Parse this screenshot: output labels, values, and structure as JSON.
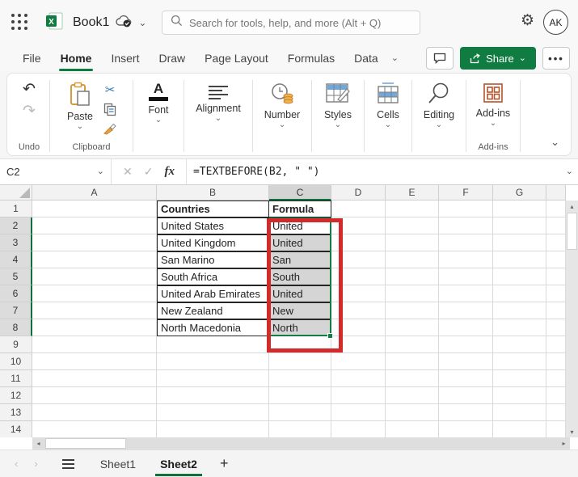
{
  "topbar": {
    "workbook_title": "Book1",
    "search_placeholder": "Search for tools, help, and more (Alt + Q)",
    "avatar_initials": "AK"
  },
  "menubar": {
    "tabs": [
      {
        "label": "File",
        "active": false
      },
      {
        "label": "Home",
        "active": true
      },
      {
        "label": "Insert",
        "active": false
      },
      {
        "label": "Draw",
        "active": false
      },
      {
        "label": "Page Layout",
        "active": false
      },
      {
        "label": "Formulas",
        "active": false
      },
      {
        "label": "Data",
        "active": false
      }
    ],
    "share_label": "Share"
  },
  "ribbon": {
    "paste_label": "Paste",
    "font_label": "Font",
    "alignment_label": "Alignment",
    "number_label": "Number",
    "styles_label": "Styles",
    "cells_label": "Cells",
    "editing_label": "Editing",
    "addins_label": "Add-ins",
    "captions": {
      "undo": "Undo",
      "clipboard": "Clipboard",
      "addins": "Add-ins"
    }
  },
  "formula_bar": {
    "name_box": "C2",
    "function_label": "fx",
    "formula": "=TEXTBEFORE(B2, \" \")"
  },
  "grid": {
    "column_labels": [
      "A",
      "B",
      "C",
      "D",
      "E",
      "F",
      "G"
    ],
    "row_count": 14,
    "selected_column": "C",
    "selected_row_start": 2,
    "selected_row_end": 8,
    "table": {
      "b_header": "Countries",
      "c_header": "Formula",
      "rows": [
        {
          "row": 2,
          "country": "United States",
          "result": "United"
        },
        {
          "row": 3,
          "country": "United Kingdom",
          "result": "United"
        },
        {
          "row": 4,
          "country": "San Marino",
          "result": "San"
        },
        {
          "row": 5,
          "country": "South Africa",
          "result": "South"
        },
        {
          "row": 6,
          "country": "United Arab Emirates",
          "result": "United"
        },
        {
          "row": 7,
          "country": "New Zealand",
          "result": "New"
        },
        {
          "row": 8,
          "country": "North Macedonia",
          "result": "North"
        }
      ]
    }
  },
  "sheet_bar": {
    "sheets": [
      {
        "label": "Sheet1",
        "active": false
      },
      {
        "label": "Sheet2",
        "active": true
      }
    ],
    "add_label": "+"
  },
  "colors": {
    "accent_green": "#107C41",
    "selection_green": "#137E43",
    "annotation_red": "#D22B2B",
    "selected_fill": "#D5D5D5"
  }
}
